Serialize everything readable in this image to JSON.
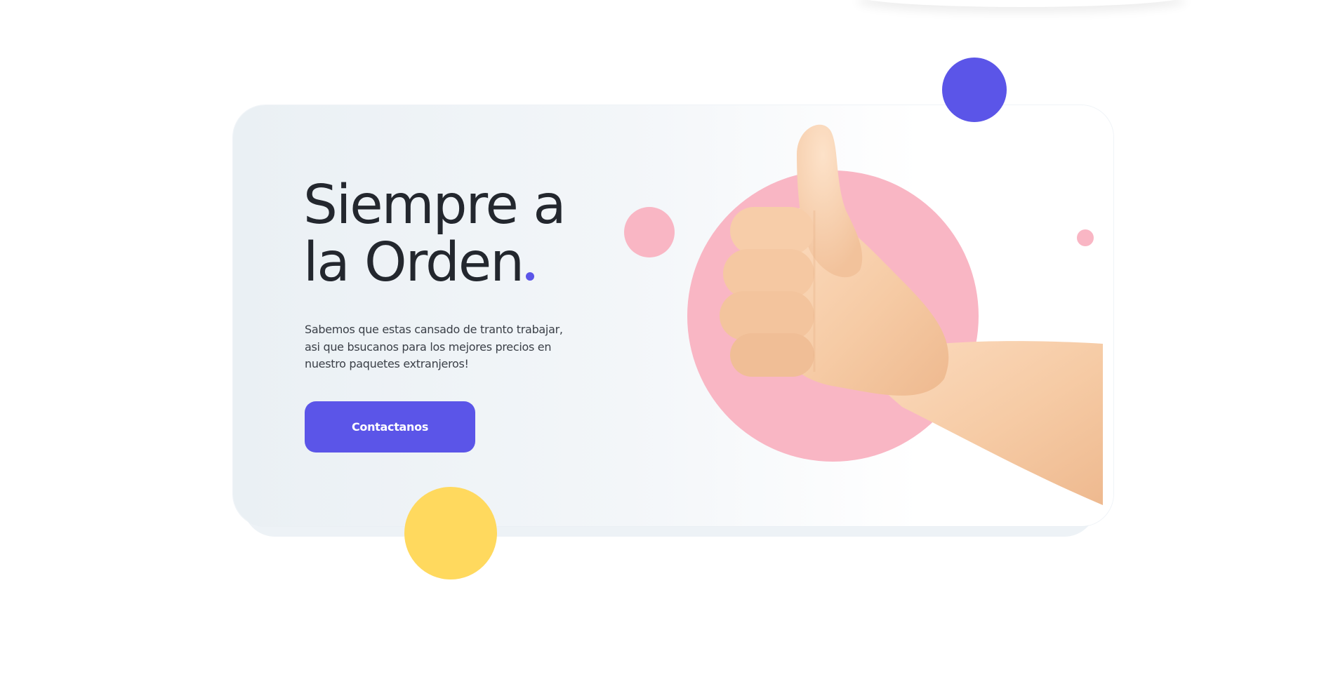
{
  "hero": {
    "headline_line1": "Siempre a",
    "headline_line2": "la Orden",
    "description": "Sabemos que estas cansado de tranto trabajar, asi que bsucanos para los mejores precios en nuestro paquetes extranjeros!",
    "cta_label": "Contactanos"
  },
  "colors": {
    "accent": "#5b55e8",
    "blue_circle": "#5b55e8",
    "yellow_circle": "#ffd95e",
    "pink_circle": "#f9b6c4",
    "skin": "#f6cba5"
  },
  "icons": {
    "hand_illustration": "thumbs-up-hand-icon"
  }
}
